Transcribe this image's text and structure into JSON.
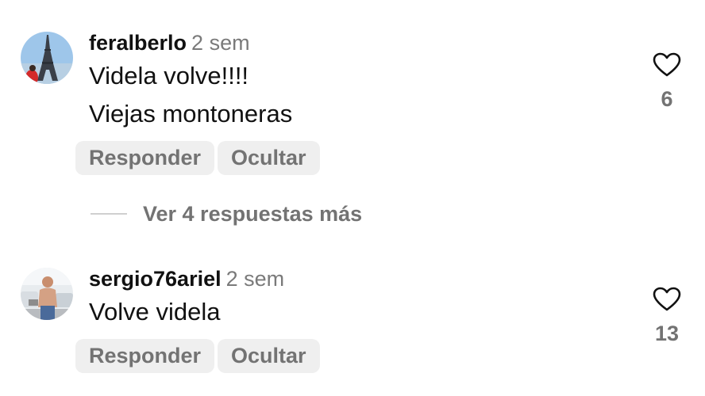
{
  "comments": [
    {
      "username": "feralberlo",
      "time": "2 sem",
      "lines": [
        "Videla volve!!!!",
        "Viejas montoneras"
      ],
      "reply_label": "Responder",
      "hide_label": "Ocultar",
      "likes": "6",
      "avatar_icon": "eiffel-tower-photo"
    },
    {
      "username": "sergio76ariel",
      "time": "2 sem",
      "lines": [
        "Volve videla"
      ],
      "reply_label": "Responder",
      "hide_label": "Ocultar",
      "likes": "13",
      "avatar_icon": "person-outdoor-photo"
    }
  ],
  "view_replies_label": "Ver 4 respuestas más",
  "icons": {
    "like": "heart-outline-icon"
  },
  "colors": {
    "text": "#111111",
    "muted": "#737373",
    "pill_bg": "#efefef"
  }
}
